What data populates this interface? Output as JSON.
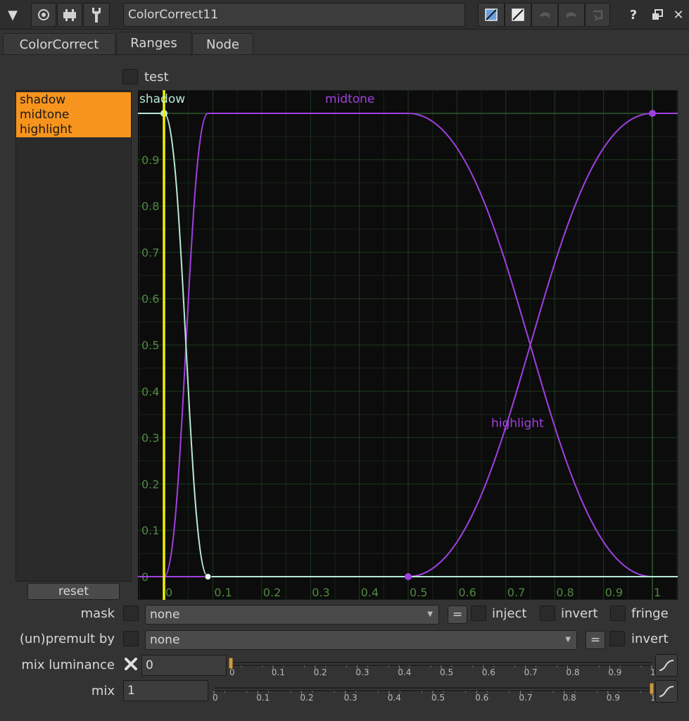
{
  "window": {
    "node_name": "ColorCorrect11",
    "toolbar_icons": [
      "collapse-arrow-icon",
      "view-node-icon",
      "vectorscope-icon",
      "wrench-icon"
    ],
    "right_icons": [
      "color-swatch-icon",
      "color-swatch-alt-icon",
      "undo-icon",
      "redo-icon",
      "revert-icon",
      "help-icon",
      "float-panel-icon",
      "close-icon"
    ],
    "help_label": "?",
    "close_label": "✕"
  },
  "tabs": [
    {
      "label": "ColorCorrect",
      "active": false
    },
    {
      "label": "Ranges",
      "active": true
    },
    {
      "label": "Node",
      "active": false
    }
  ],
  "test_label": "test",
  "curves": {
    "items": [
      "shadow",
      "midtone",
      "highlight"
    ],
    "reset_label": "reset",
    "colors": {
      "shadow": "#b8e8d8",
      "midtone": "#a040e0",
      "highlight": "#a040e0",
      "cursor": "#f0f000",
      "selection": "#f7941d"
    }
  },
  "chart_data": {
    "type": "line",
    "xlim": [
      0,
      1
    ],
    "ylim": [
      0,
      1
    ],
    "x_ticks": [
      "0",
      "0.1",
      "0.2",
      "0.3",
      "0.4",
      "0.5",
      "0.6",
      "0.7",
      "0.8",
      "0.9",
      "1"
    ],
    "y_ticks": [
      "0",
      "0.1",
      "0.2",
      "0.3",
      "0.4",
      "0.5",
      "0.6",
      "0.7",
      "0.8",
      "0.9"
    ],
    "grid": true,
    "cursor_x": 0,
    "series": [
      {
        "name": "shadow",
        "keys": [
          [
            0,
            1
          ],
          [
            0.09,
            0
          ]
        ]
      },
      {
        "name": "midtone",
        "keys": [
          [
            0,
            0
          ],
          [
            0.09,
            1
          ],
          [
            0.5,
            1
          ],
          [
            1,
            0
          ]
        ]
      },
      {
        "name": "highlight",
        "keys": [
          [
            0.5,
            0
          ],
          [
            1,
            1
          ]
        ]
      }
    ],
    "label_positions": [
      {
        "name": "shadow",
        "x": 0.0,
        "y": 1.02
      },
      {
        "name": "midtone",
        "x": 0.33,
        "y": 1.02
      },
      {
        "name": "highlight",
        "x": 0.67,
        "y": 0.32
      }
    ]
  },
  "mask": {
    "label": "mask",
    "value": "none",
    "eq": "=",
    "inject": "inject",
    "invert": "invert",
    "fringe": "fringe"
  },
  "premult": {
    "label": "(un)premult by",
    "value": "none",
    "eq": "=",
    "invert": "invert"
  },
  "mix_luminance": {
    "label": "mix luminance",
    "value": "0",
    "slider": 0,
    "ticks": [
      "0",
      "0.1",
      "0.2",
      "0.3",
      "0.4",
      "0.5",
      "0.6",
      "0.7",
      "0.8",
      "0.9",
      "1"
    ]
  },
  "mix": {
    "label": "mix",
    "value": "1",
    "slider": 1,
    "ticks": [
      "0",
      "0.1",
      "0.2",
      "0.3",
      "0.4",
      "0.5",
      "0.6",
      "0.7",
      "0.8",
      "0.9",
      "1"
    ]
  }
}
